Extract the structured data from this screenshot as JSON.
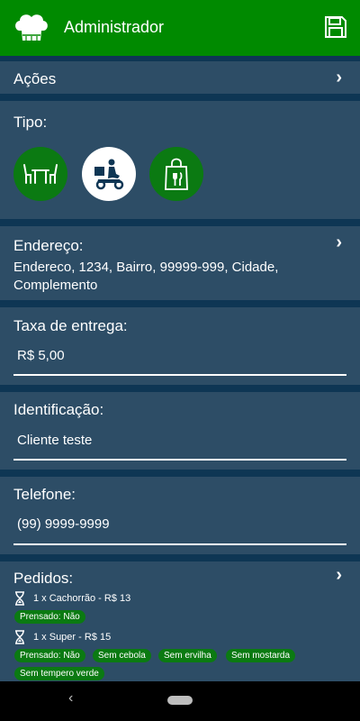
{
  "header": {
    "title": "Administrador",
    "bg_color": "#008a00"
  },
  "acoes": {
    "label": "Ações"
  },
  "tipo": {
    "label": "Tipo:",
    "options": [
      {
        "icon": "dine-in-table-icon",
        "selected": false
      },
      {
        "icon": "delivery-motorbike-icon",
        "selected": true
      },
      {
        "icon": "takeaway-bag-icon",
        "selected": false
      }
    ]
  },
  "endereco": {
    "label": "Endereço:",
    "value": "Endereco, 1234, Bairro, 99999-999, Cidade, Complemento"
  },
  "taxa": {
    "label": "Taxa de entrega:",
    "value": "R$ 5,00"
  },
  "identificacao": {
    "label": "Identificação:",
    "value": "Cliente teste"
  },
  "telefone": {
    "label": "Telefone:",
    "value": "(99) 9999-9999"
  },
  "pedidos": {
    "label": "Pedidos:",
    "items": [
      {
        "text": "1 x Cachorrão - R$ 13",
        "tags": [
          "Prensado: Não"
        ]
      },
      {
        "text": "1 x Super - R$ 15",
        "tags": [
          "Prensado: Não",
          "Sem cebola",
          "Sem ervilha",
          "Sem mostarda",
          "Sem tempero verde"
        ]
      }
    ]
  },
  "colors": {
    "background": "#0e3654",
    "card": "#2d4d66",
    "accent": "#0b7a12"
  }
}
